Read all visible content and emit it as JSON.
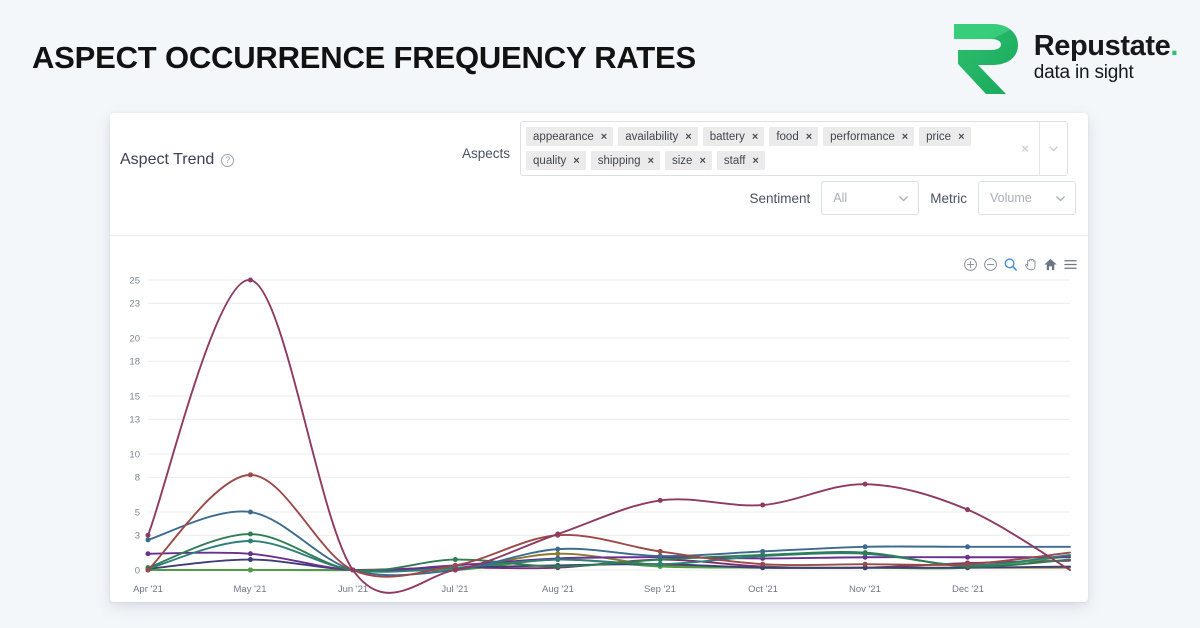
{
  "banner": {
    "title": "ASPECT OCCURRENCE FREQUENCY RATES",
    "logo_name": "Repustate",
    "logo_dot": ".",
    "logo_tagline": "data in sight"
  },
  "card": {
    "panel_title": "Aspect Trend",
    "help_icon": "question-mark-circle-icon"
  },
  "aspects": {
    "label": "Aspects",
    "tags": [
      {
        "label": "appearance",
        "remove": "×"
      },
      {
        "label": "availability",
        "remove": "×"
      },
      {
        "label": "battery",
        "remove": "×"
      },
      {
        "label": "food",
        "remove": "×"
      },
      {
        "label": "performance",
        "remove": "×"
      },
      {
        "label": "price",
        "remove": "×"
      },
      {
        "label": "quality",
        "remove": "×"
      },
      {
        "label": "shipping",
        "remove": "×"
      },
      {
        "label": "size",
        "remove": "×"
      },
      {
        "label": "staff",
        "remove": "×"
      }
    ],
    "clear_all": "×",
    "dropdown_icon": "chevron-down-icon"
  },
  "controls": {
    "sentiment_label": "Sentiment",
    "sentiment_value": "All",
    "metric_label": "Metric",
    "metric_value": "Volume"
  },
  "toolbar": {
    "zoom_in": "zoom-in-icon",
    "zoom_out": "zoom-out-icon",
    "selection_zoom": "selection-zoom-icon",
    "panning": "panning-hand-icon",
    "reset": "home-reset-icon",
    "menu": "hamburger-menu-icon",
    "active_tool": "selection-zoom",
    "active_color": "#3f8ed0"
  },
  "chart_data": {
    "type": "line",
    "title": "Aspect Trend",
    "xlabel": "",
    "ylabel": "",
    "x": [
      "Apr '21",
      "May '21",
      "Jun '21",
      "Jul '21",
      "Aug '21",
      "Sep '21",
      "Oct '21",
      "Nov '21",
      "Dec '21",
      ""
    ],
    "ytick_labels": [
      "25",
      "23",
      "20",
      "18",
      "15",
      "13",
      "10",
      "8",
      "5",
      "3",
      "0"
    ],
    "ytick_values": [
      25,
      23,
      20,
      18,
      15,
      13,
      10,
      8,
      5,
      3,
      0
    ],
    "ylim": [
      0,
      25
    ],
    "grid": true,
    "legend": "none",
    "series": [
      {
        "name": "quality",
        "color": "#8e3a63",
        "values": [
          3,
          25,
          0,
          0,
          3.1,
          6,
          5.6,
          7.4,
          5.2,
          0
        ]
      },
      {
        "name": "price",
        "color": "#9b4a48",
        "values": [
          0,
          8.2,
          0,
          0.4,
          3.0,
          1.6,
          0.5,
          0.5,
          0.5,
          1.5
        ]
      },
      {
        "name": "performance",
        "color": "#3d6a8f",
        "values": [
          2.6,
          5.0,
          0,
          0,
          1.8,
          1.2,
          1.6,
          2.0,
          2.0,
          2.0
        ]
      },
      {
        "name": "food",
        "color": "#2f7d52",
        "values": [
          0.2,
          3.1,
          0,
          0.9,
          0.3,
          0.9,
          1.3,
          1.5,
          0.3,
          0.9
        ]
      },
      {
        "name": "battery",
        "color": "#2f7f7b",
        "values": [
          0.1,
          2.5,
          0,
          0.2,
          0.9,
          0.5,
          1.2,
          1.4,
          0.4,
          1.3
        ]
      },
      {
        "name": "appearance",
        "color": "#6b2f8f",
        "values": [
          1.4,
          1.4,
          0,
          0.4,
          1.0,
          1.1,
          1.0,
          1.1,
          1.1,
          1.1
        ]
      },
      {
        "name": "availability",
        "color": "#3d3f77",
        "values": [
          0.1,
          0.9,
          0,
          0.2,
          0.4,
          0.5,
          0.2,
          0.2,
          0.2,
          0.3
        ]
      },
      {
        "name": "shipping",
        "color": "#4f9e45",
        "values": [
          0,
          0,
          0,
          0,
          0.9,
          0.3,
          0.2,
          0.2,
          0.2,
          1.2
        ]
      },
      {
        "name": "size",
        "color": "#8a7a2e",
        "values": [
          0,
          0,
          0,
          0.1,
          1.4,
          0.4,
          0.2,
          0.2,
          0.2,
          0.2
        ]
      },
      {
        "name": "staff",
        "color": "#7b2f6b",
        "values": [
          0,
          0,
          0,
          0.2,
          0.2,
          0.9,
          0.3,
          0.2,
          0.6,
          0.8
        ]
      }
    ]
  }
}
